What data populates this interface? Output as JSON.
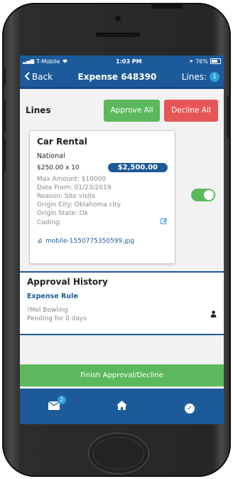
{
  "status_bar": {
    "carrier": "T-Mobile",
    "time": "1:03 PM",
    "battery": "76%"
  },
  "navbar": {
    "back_label": "Back",
    "title": "Expense 648390",
    "lines_label": "Lines:",
    "lines_count": "1"
  },
  "lines_section": {
    "title": "Lines",
    "approve_all_label": "Approve All",
    "decline_all_label": "Decline All"
  },
  "line_card": {
    "title": "Car Rental",
    "vendor": "National",
    "quantity": "$250.00 x 10",
    "amount": "$2,500.00",
    "max_amount": "Max Amount: $10000",
    "date_from": "Date From: 01/23/2019",
    "reason": "Reason: Site visits",
    "origin_city": "Origin City: Oklahoma city",
    "origin_state": "Origin State: Ok",
    "coding": "Coding:",
    "attachment": "mobile-1550775350599.jpg",
    "approved": true
  },
  "approval_history": {
    "title": "Approval History",
    "rule": "Expense Rule",
    "approver": "!Mel Bowling",
    "status": "Pending for 0 days"
  },
  "footer": {
    "finish_label": "Finish Approval/Decline",
    "mail_badge": "2"
  },
  "colors": {
    "brand_blue": "#1d5a9a",
    "approve_green": "#5cb85c",
    "decline_red": "#e75656",
    "badge_blue": "#2ba0e0"
  },
  "icons": [
    "wifi-icon",
    "battery-icon",
    "chevron-left-icon",
    "edit-icon",
    "paperclip-icon",
    "person-icon",
    "mail-icon",
    "home-icon",
    "check-circle-icon"
  ]
}
